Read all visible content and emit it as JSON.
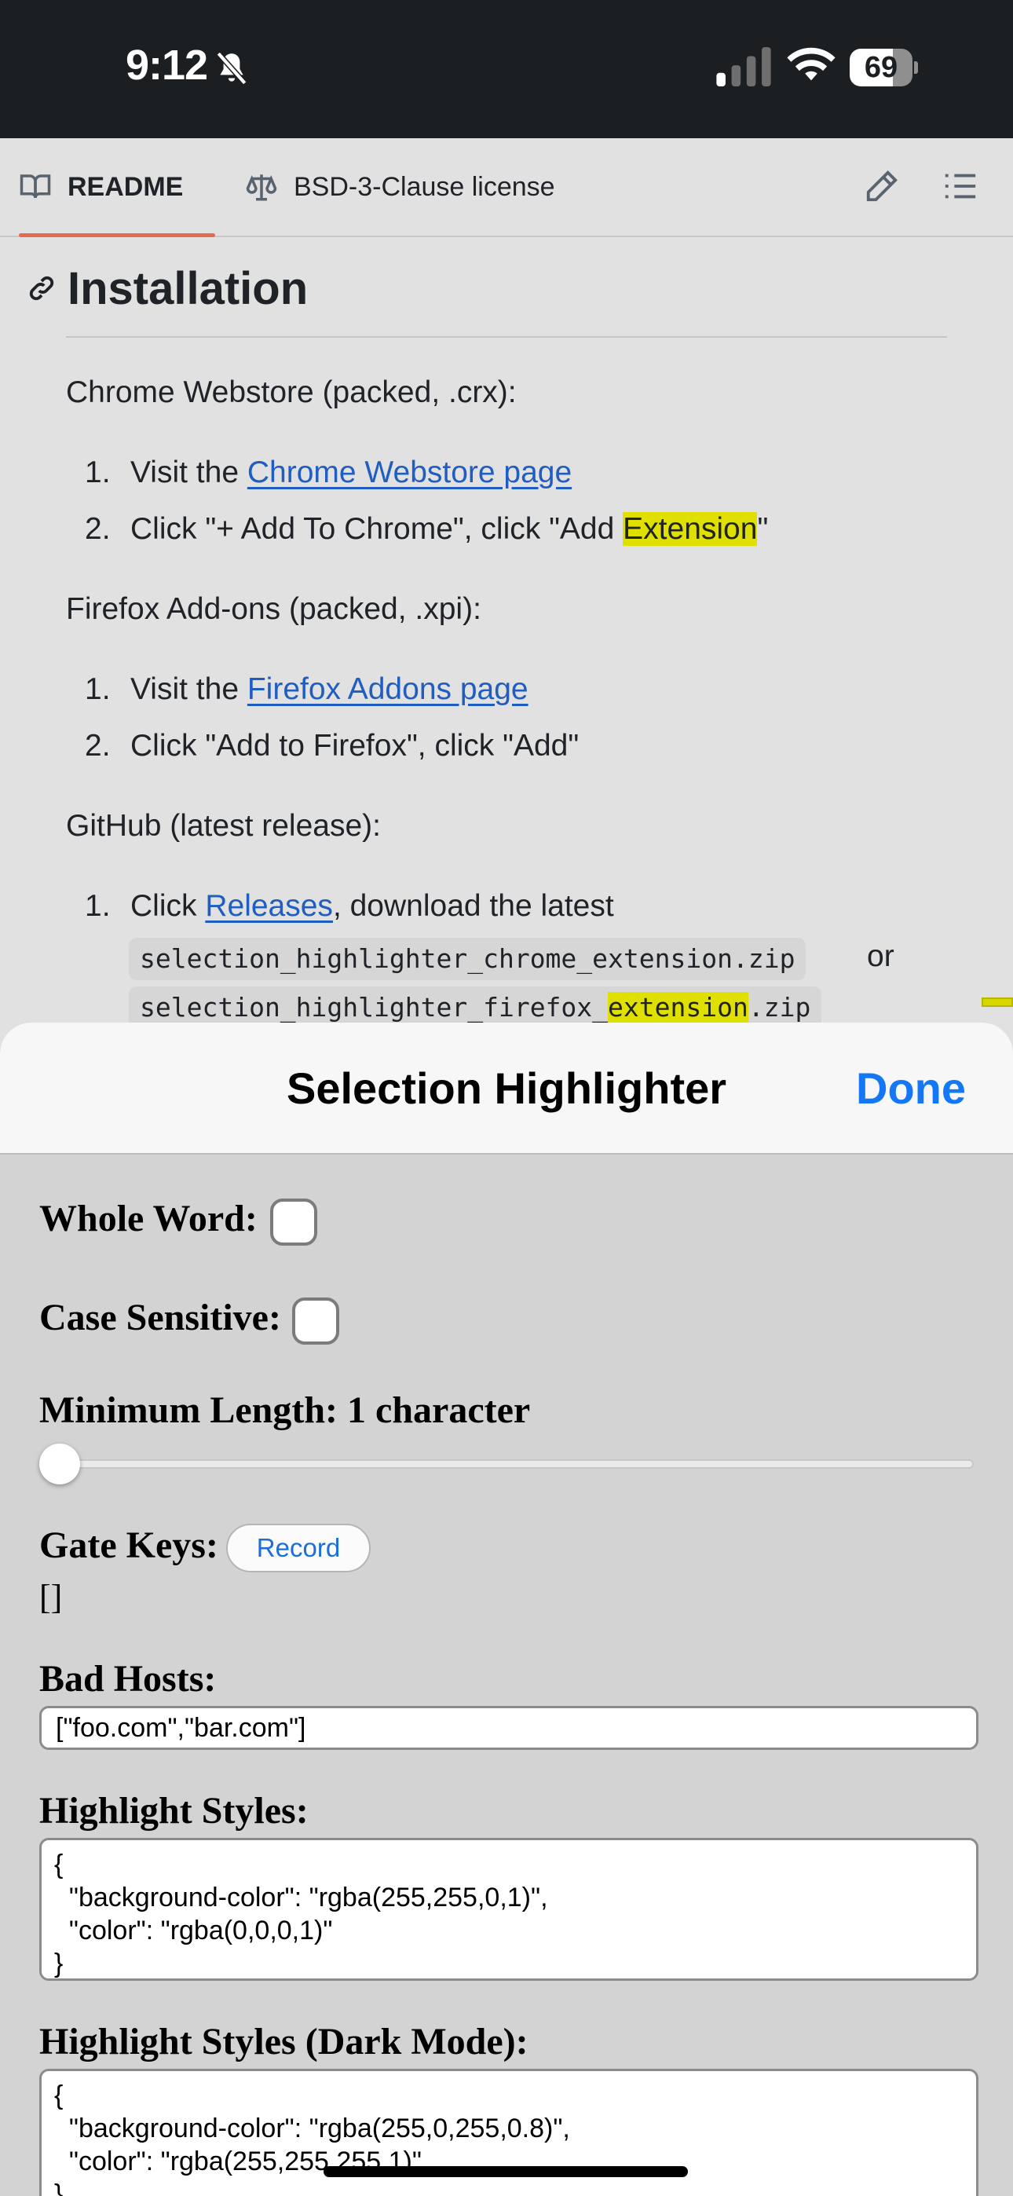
{
  "status_bar": {
    "time": "9:12",
    "battery": "69",
    "battery_level": 0.69,
    "icons": [
      "bell-slash-icon",
      "signal-icon",
      "wifi-icon",
      "battery-icon"
    ]
  },
  "webpage": {
    "tabs": [
      {
        "label": "README",
        "icon": "book-icon",
        "active": true
      },
      {
        "label": "BSD-3-Clause license",
        "icon": "scale-icon",
        "active": false
      }
    ],
    "actions": [
      "pencil-icon",
      "list-icon"
    ],
    "heading": "Installation",
    "chrome": {
      "intro": "Chrome Webstore (packed, .crx):",
      "step1_prefix": "Visit the ",
      "step1_link": "Chrome Webstore page",
      "step2_prefix": "Click \"+ Add To Chrome\", click \"Add ",
      "step2_highlight": "Extension",
      "step2_suffix": "\""
    },
    "firefox": {
      "intro": "Firefox Add-ons (packed, .xpi):",
      "step1_prefix": "Visit the ",
      "step1_link": "Firefox Addons page",
      "step2": "Click \"Add to Firefox\", click \"Add\""
    },
    "github": {
      "intro": "GitHub (latest release):",
      "step1_prefix": "Click ",
      "step1_link": "Releases",
      "step1_suffix": ", download the latest",
      "code1": "selection_highlighter_chrome_extension.zip",
      "or": "or",
      "code2_prefix": "selection_highlighter_firefox_",
      "code2_highlight": "extension",
      "code2_suffix": ".zip"
    },
    "numbers": [
      "1.",
      "2."
    ],
    "accent_color": "#e66a4f",
    "link_color": "#1f5dc1",
    "highlight_color": "#e0e000"
  },
  "sheet": {
    "title": "Selection Highlighter",
    "done": "Done",
    "whole_word_label": "Whole Word:",
    "whole_word_checked": false,
    "case_sensitive_label": "Case Sensitive:",
    "case_sensitive_checked": false,
    "min_length_label": "Minimum Length: 1 character",
    "min_length_value": 1,
    "gate_keys_label": "Gate Keys:",
    "record_button": "Record",
    "gate_keys_value": "[]",
    "bad_hosts_label": "Bad Hosts:",
    "bad_hosts_value": "[\"foo.com\",\"bar.com\"]",
    "styles_label": "Highlight Styles:",
    "styles_value": "{\n  \"background-color\": \"rgba(255,255,0,1)\",\n  \"color\": \"rgba(0,0,0,1)\"\n}",
    "dark_styles_label": "Highlight Styles (Dark Mode):",
    "dark_styles_value": "{\n  \"background-color\": \"rgba(255,0,255,0.8)\",\n  \"color\": \"rgba(255,255,255,1)\"\n}",
    "done_color": "#1477f6"
  }
}
